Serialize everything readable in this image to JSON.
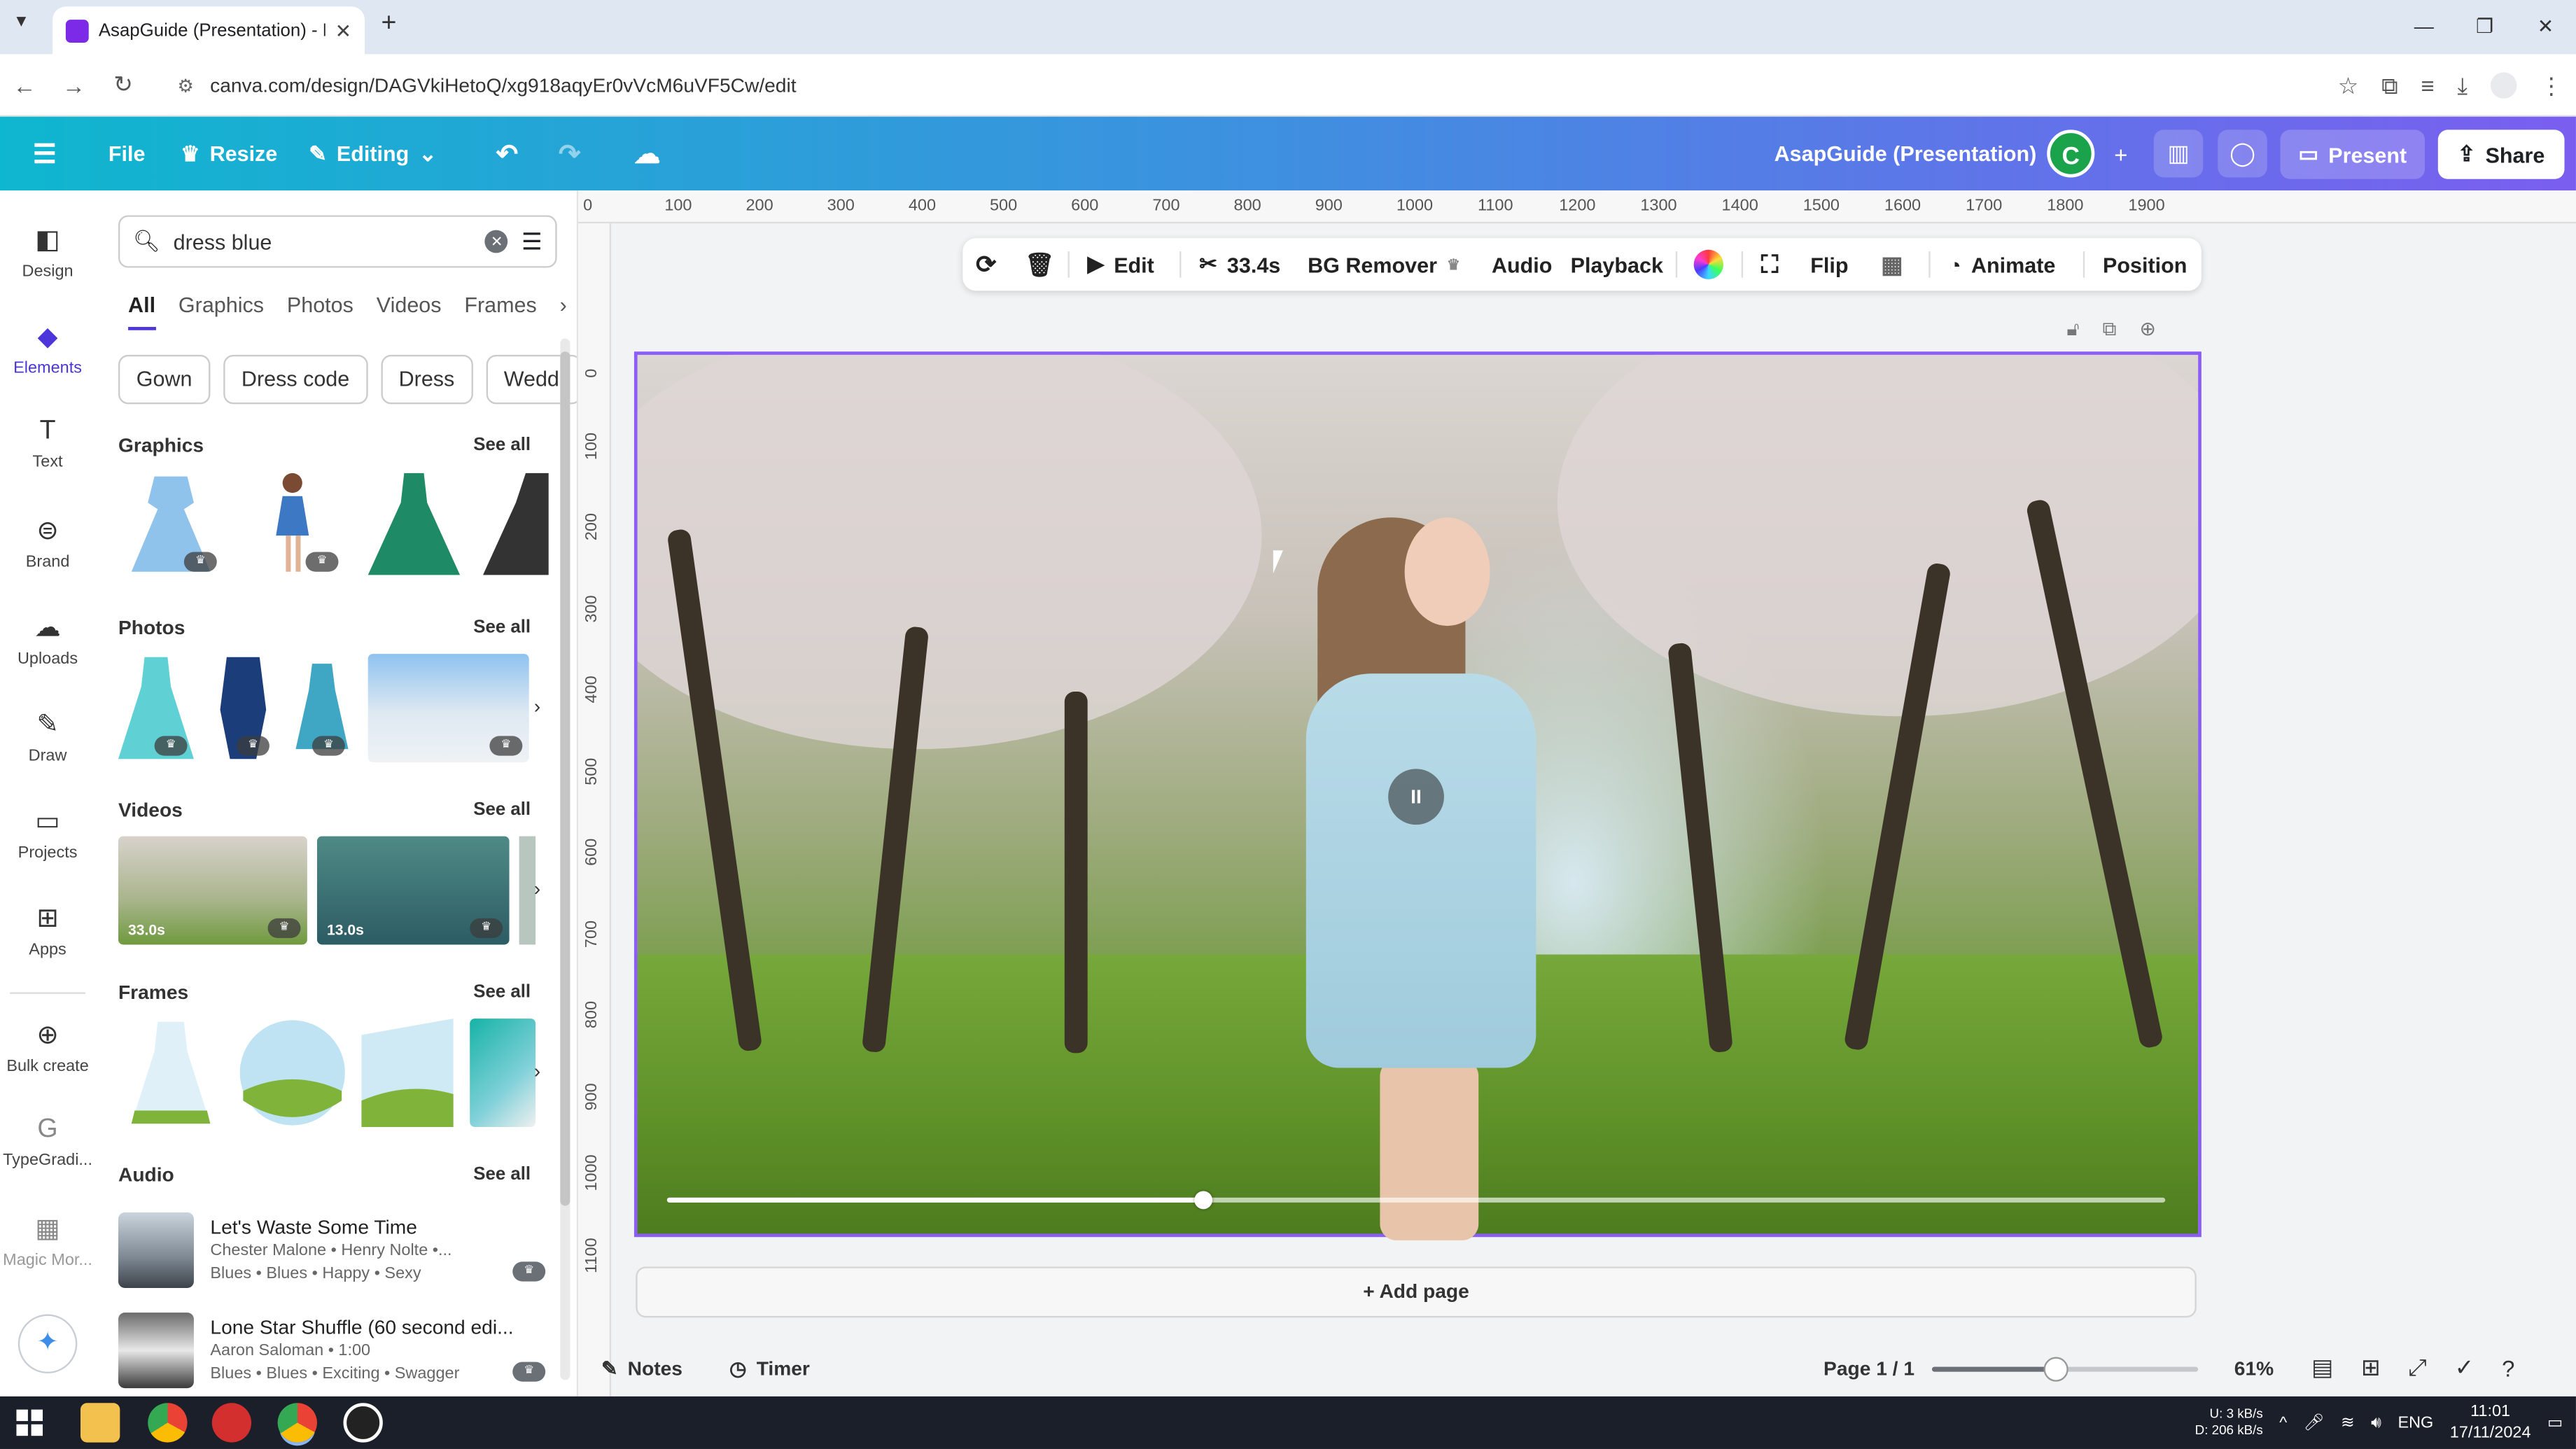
{
  "browser": {
    "tab_title": "AsapGuide (Presentation) - Pre",
    "url": "canva.com/design/DAGVkiHetoQ/xg918aqyEr0vVcM6uVF5Cw/edit"
  },
  "topbar": {
    "file": "File",
    "resize": "Resize",
    "editing": "Editing",
    "doc_title": "AsapGuide (Presentation)",
    "avatar_initial": "C",
    "present": "Present",
    "share": "Share",
    "accent_start": "#0fb6cf",
    "accent_end": "#7a5ef0"
  },
  "rail": {
    "items": [
      {
        "label": "Design",
        "icon": "design-icon"
      },
      {
        "label": "Elements",
        "icon": "elements-icon"
      },
      {
        "label": "Text",
        "icon": "text-icon"
      },
      {
        "label": "Brand",
        "icon": "brand-icon"
      },
      {
        "label": "Uploads",
        "icon": "uploads-icon"
      },
      {
        "label": "Draw",
        "icon": "draw-icon"
      },
      {
        "label": "Projects",
        "icon": "projects-icon"
      },
      {
        "label": "Apps",
        "icon": "apps-icon"
      },
      {
        "label": "Bulk create",
        "icon": "bulk-create-icon"
      },
      {
        "label": "TypeGradi...",
        "icon": "typegradient-icon"
      },
      {
        "label": "Magic Mor...",
        "icon": "magic-morph-icon"
      }
    ]
  },
  "panel": {
    "search_value": "dress blue",
    "tabs": [
      "All",
      "Graphics",
      "Photos",
      "Videos",
      "Frames"
    ],
    "chips": [
      "Gown",
      "Dress code",
      "Dress",
      "Weddi"
    ],
    "sections": {
      "graphics": "Graphics",
      "photos": "Photos",
      "videos": "Videos",
      "frames": "Frames",
      "audio": "Audio"
    },
    "see_all": "See all",
    "video_durations": [
      "33.0s",
      "13.0s"
    ],
    "audio": [
      {
        "title": "Let's Waste Some Time",
        "artist": "Chester Malone • Henry Nolte •...",
        "tags": "Blues • Blues • Happy • Sexy"
      },
      {
        "title": "Lone Star Shuffle (60 second edi...",
        "artist": "Aaron Saloman • 1:00",
        "tags": "Blues • Blues • Exciting • Swagger"
      }
    ]
  },
  "ruler": {
    "h": [
      "0",
      "100",
      "200",
      "300",
      "400",
      "500",
      "600",
      "700",
      "800",
      "900",
      "1000",
      "1100",
      "1200",
      "1300",
      "1400",
      "1500",
      "1600",
      "1700",
      "1800",
      "1900"
    ],
    "v": [
      "0",
      "100",
      "200",
      "300",
      "400",
      "500",
      "600",
      "700",
      "800",
      "900",
      "1000",
      "1100"
    ]
  },
  "context_toolbar": {
    "edit": "Edit",
    "duration": "33.4s",
    "bg_remover": "BG Remover",
    "audio": "Audio",
    "playback": "Playback",
    "flip": "Flip",
    "animate": "Animate",
    "position": "Position"
  },
  "video": {
    "progress": 0.357,
    "pause_glyph": "II"
  },
  "canvas": {
    "add_page": "+ Add page",
    "selection_color": "#8b5cf6"
  },
  "statusbar": {
    "notes": "Notes",
    "timer": "Timer",
    "page": "Page 1 / 1",
    "zoom": "61%",
    "zoom_level": 0.46
  },
  "taskbar": {
    "net_up": "3 kB/s",
    "net_down": "206 kB/s",
    "net_up_label": "U:",
    "net_down_label": "D:",
    "lang": "ENG",
    "time": "11:01",
    "date": "17/11/2024"
  }
}
